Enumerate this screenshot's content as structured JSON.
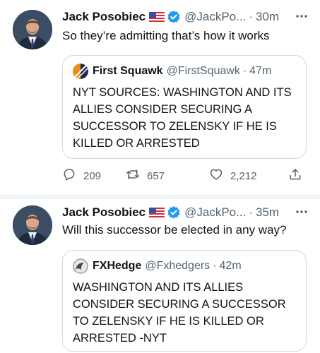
{
  "tweets": [
    {
      "author_name": "Jack Posobiec",
      "handle": "@JackPo...",
      "time": "30m",
      "text": "So they’re admitting that’s how it works",
      "quote": {
        "author_name": "First Squawk",
        "handle": "@FirstSquawk",
        "time": "47m",
        "text": "NYT SOURCES: WASHINGTON AND ITS ALLIES CONSIDER SECURING A SUCCESSOR TO ZELENSKY IF HE IS KILLED OR ARRESTED"
      },
      "actions": {
        "replies": "209",
        "retweets": "657",
        "likes": "2,212"
      }
    },
    {
      "author_name": "Jack Posobiec",
      "handle": "@JackPo...",
      "time": "35m",
      "text": "Will this successor be elected in any way?",
      "quote": {
        "author_name": "FXHedge",
        "handle": "@Fxhedgers",
        "time": "42m",
        "text": "WASHINGTON AND ITS ALLIES CONSIDER SECURING A SUCCESSOR TO ZELENSKY IF HE IS KILLED OR ARRESTED -NYT"
      }
    }
  ],
  "separator": "·",
  "icons": {
    "more": "more-dots-icon",
    "flag": "us-flag-icon",
    "verified": "verified-badge-icon",
    "reply": "reply-icon",
    "retweet": "retweet-icon",
    "like": "heart-icon",
    "share": "share-icon"
  },
  "colors": {
    "text": "#0f1419",
    "secondary": "#536471",
    "verified": "#1d9bf0",
    "border": "#cfd9de",
    "divider": "#eff3f4"
  }
}
